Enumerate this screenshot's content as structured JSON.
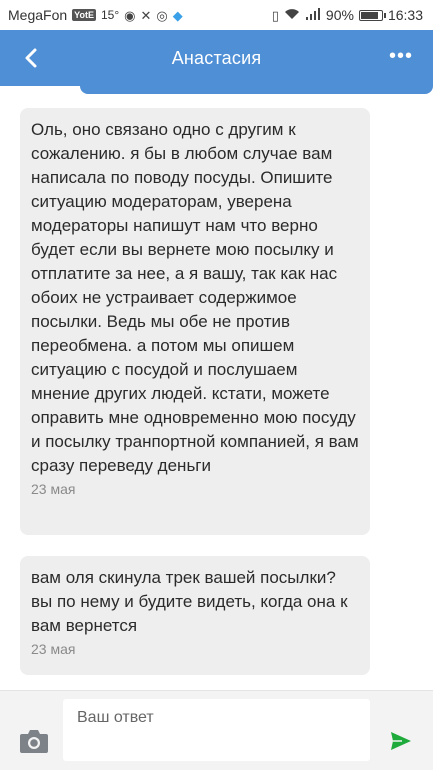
{
  "statusbar": {
    "carrier": "MegaFon",
    "badge": "YotE",
    "temperature": "15°",
    "battery_percent": "90%",
    "battery_level": 0.9,
    "time": "16:33"
  },
  "header": {
    "title": "Анастасия",
    "more_label": "•••"
  },
  "messages": [
    {
      "text": "Оль, оно связано одно с другим к сожалению. я бы в любом случае вам написала по поводу посуды. Опишите ситуацию модераторам, уверена модераторы напишут нам что верно будет если вы вернете мою посылку и отплатите за нее, а я вашу, так как нас обоих не устраивает содержимое посылки. Ведь мы обе не против переобмена. а потом мы опишем ситуацию с посудой и послушаем мнение других людей. кстати, можете оправить мне одновременно мою посуду и посылку транпортной компанией, я вам сразу переведу деньги",
      "date": "23 мая"
    },
    {
      "text": "вам оля скинула трек вашей посылки? вы по нему и будите видеть, когда она к вам вернется",
      "date": "23 мая"
    }
  ],
  "composer": {
    "placeholder": "Ваш ответ"
  },
  "colors": {
    "header": "#4f8fd6",
    "bubble": "#eeeeee",
    "send": "#1faa3c"
  },
  "icons": {
    "back": "chevron-left-icon",
    "more": "more-horizontal-icon",
    "camera": "camera-icon",
    "send": "send-icon"
  }
}
